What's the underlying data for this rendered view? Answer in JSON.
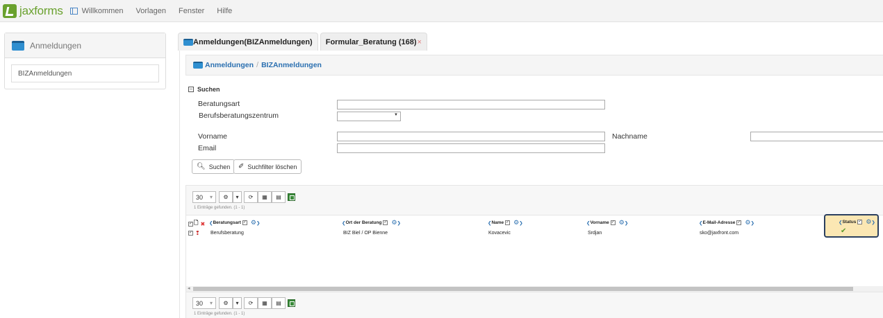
{
  "app": {
    "logo_text": "jaxforms",
    "brand_color": "#6aa12e",
    "link_color": "#2a6fb0"
  },
  "menu": [
    {
      "label": "Willkommen"
    },
    {
      "label": "Vorlagen"
    },
    {
      "label": "Fenster"
    },
    {
      "label": "Hilfe"
    }
  ],
  "left": {
    "title": "Anmeldungen",
    "item": "BIZAnmeldungen"
  },
  "tabs": [
    {
      "label": "Anmeldungen(BIZAnmeldungen)",
      "active": true
    },
    {
      "label": "Formular_Beratung (168)",
      "close": "×"
    }
  ],
  "breadcrumb": {
    "root": "Anmeldungen",
    "sep": "/",
    "current": "BIZAnmeldungen"
  },
  "search": {
    "title": "Suchen",
    "toggle": "⊟",
    "fields": {
      "beratungsart": {
        "label": "Beratungsart",
        "value": ""
      },
      "zentrum": {
        "label": "Berufsberatungszentrum",
        "value": ""
      },
      "vorname": {
        "label": "Vorname",
        "value": ""
      },
      "nachname": {
        "label": "Nachname",
        "value": ""
      },
      "email": {
        "label": "Email",
        "value": ""
      }
    },
    "search_button": "Suchen",
    "clear_button": "Suchfilter löschen"
  },
  "grid": {
    "page_size": "30",
    "found_text": "1 Einträge gefunden. (1 - 1)",
    "columns": [
      {
        "label": "Beratungsart"
      },
      {
        "label": "Ort der Beratung"
      },
      {
        "label": "Name"
      },
      {
        "label": "Vorname"
      },
      {
        "label": "E-Mail-Adresse"
      },
      {
        "label": "Status"
      }
    ],
    "rows": [
      {
        "beratungsart": "Berufsberatung",
        "ort": "BIZ Biel / OP Bienne",
        "name": "Kovacevic",
        "vorname": "Srdjan",
        "email": "sko@jaxfront.com",
        "status": "✔"
      }
    ]
  }
}
